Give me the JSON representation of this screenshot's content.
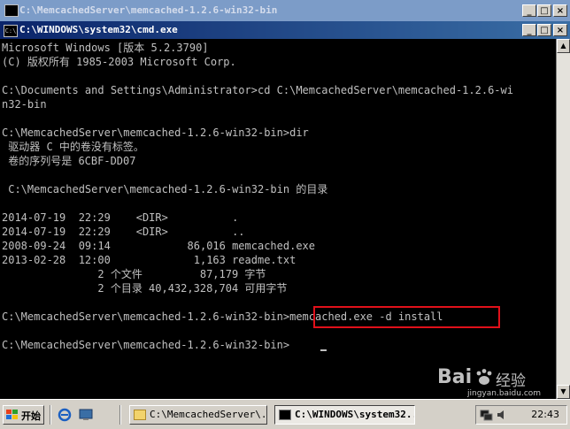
{
  "outer_window": {
    "title": "C:\\MemcachedServer\\memcached-1.2.6-win32-bin",
    "buttons": {
      "minimize": "_",
      "maximize": "□",
      "close": "×"
    }
  },
  "cmd_window": {
    "title": "C:\\WINDOWS\\system32\\cmd.exe",
    "buttons": {
      "minimize": "_",
      "maximize": "□",
      "close": "×"
    }
  },
  "console": {
    "lines": [
      "Microsoft Windows [版本 5.2.3790]",
      "(C) 版权所有 1985-2003 Microsoft Corp.",
      "",
      "C:\\Documents and Settings\\Administrator>cd C:\\MemcachedServer\\memcached-1.2.6-wi",
      "n32-bin",
      "",
      "C:\\MemcachedServer\\memcached-1.2.6-win32-bin>dir",
      " 驱动器 C 中的卷没有标签。",
      " 卷的序列号是 6CBF-DD07",
      "",
      " C:\\MemcachedServer\\memcached-1.2.6-win32-bin 的目录",
      "",
      "2014-07-19  22:29    <DIR>          .",
      "2014-07-19  22:29    <DIR>          ..",
      "2008-09-24  09:14            86,016 memcached.exe",
      "2013-02-28  12:00             1,163 readme.txt",
      "               2 个文件         87,179 字节",
      "               2 个目录 40,432,328,704 可用字节",
      "",
      "C:\\MemcachedServer\\memcached-1.2.6-win32-bin>memcached.exe -d install",
      "",
      "C:\\MemcachedServer\\memcached-1.2.6-win32-bin>"
    ]
  },
  "taskbar": {
    "start_label": "开始",
    "tasks": [
      {
        "label": "C:\\MemcachedServer\\...",
        "active": false
      },
      {
        "label": "C:\\WINDOWS\\system32...",
        "active": true
      }
    ],
    "clock": "22:43"
  },
  "watermark": {
    "brand": "Bai",
    "brand_suffix": "经验",
    "url": "jingyan.baidu.com"
  },
  "colors": {
    "console_bg": "#000000",
    "console_text": "#c0c0c0",
    "highlight_border": "#e0101a",
    "cmd_titlebar_start": "#0a246a",
    "cmd_titlebar_end": "#3a6ea5"
  },
  "icons": [
    "cmd-icon",
    "folder-icon",
    "windows-flag-icon",
    "ie-icon",
    "desktop-icon",
    "tray-network-icon",
    "tray-volume-icon"
  ]
}
